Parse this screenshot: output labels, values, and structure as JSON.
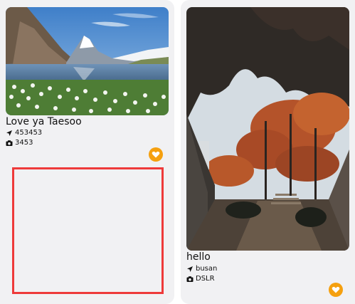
{
  "posts": [
    {
      "title": "Love ya Taesoo",
      "location": "453453",
      "camera": "3453",
      "location_icon": "location-arrow-icon",
      "camera_icon": "camera-icon",
      "like_icon": "heart-icon",
      "accent": "#f5a00f"
    },
    {
      "title": "hello",
      "location": "busan",
      "camera": "DSLR",
      "location_icon": "location-arrow-icon",
      "camera_icon": "camera-icon",
      "like_icon": "heart-icon",
      "accent": "#f5a00f"
    }
  ],
  "placeholder_border_color": "#ee3a3a"
}
